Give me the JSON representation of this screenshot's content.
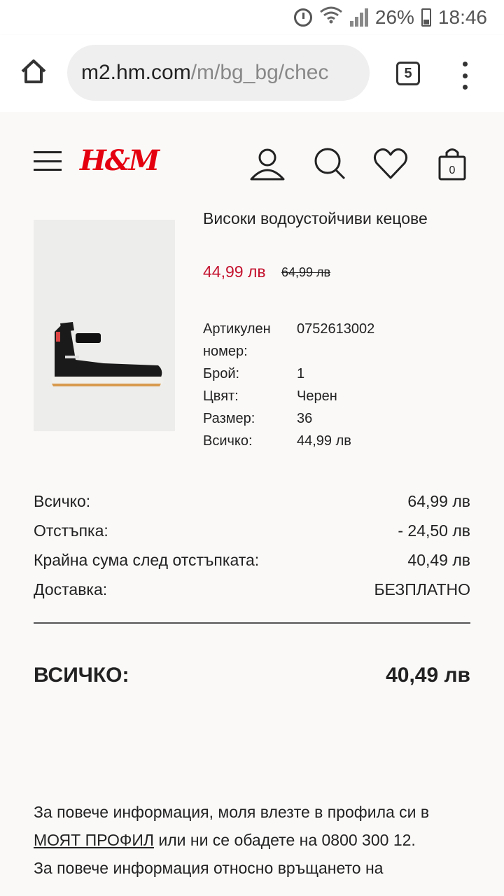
{
  "status_bar": {
    "battery": "26%",
    "time": "18:46"
  },
  "browser": {
    "url_host": "m2.hm.com",
    "url_path": "/m/bg_bg/chec",
    "tab_count": "5"
  },
  "header": {
    "logo": "H&M",
    "bag_count": "0"
  },
  "product": {
    "title": "Високи водоустойчиви кецове",
    "price_now": "44,99 лв",
    "price_old": "64,99 лв",
    "details": [
      {
        "label": "Артикулен номер:",
        "value": "0752613002"
      },
      {
        "label": "Брой:",
        "value": "1"
      },
      {
        "label": "Цвят:",
        "value": "Черен"
      },
      {
        "label": "Размер:",
        "value": "36"
      },
      {
        "label": "Всичко:",
        "value": "44,99 лв"
      }
    ]
  },
  "summary": {
    "rows": [
      {
        "label": "Всичко:",
        "value": "64,99 лв"
      },
      {
        "label": "Отстъпка:",
        "value": "- 24,50 лв"
      },
      {
        "label": "Крайна сума след отстъпката:",
        "value": "40,49 лв"
      },
      {
        "label": "Доставка:",
        "value": "БЕЗПЛАТНО"
      }
    ],
    "grand_label": "ВСИЧКО:",
    "grand_value": "40,49 лв"
  },
  "info": {
    "text_before": "За повече информация, моля влезте в профила си в ",
    "link": "МОЯТ ПРОФИЛ",
    "text_after": " или ни се обадете на 0800 300 12.",
    "text_cut": "За повече информация относно връщането на"
  },
  "colors": {
    "brand_red": "#e50010",
    "sale_red": "#c4132e"
  }
}
